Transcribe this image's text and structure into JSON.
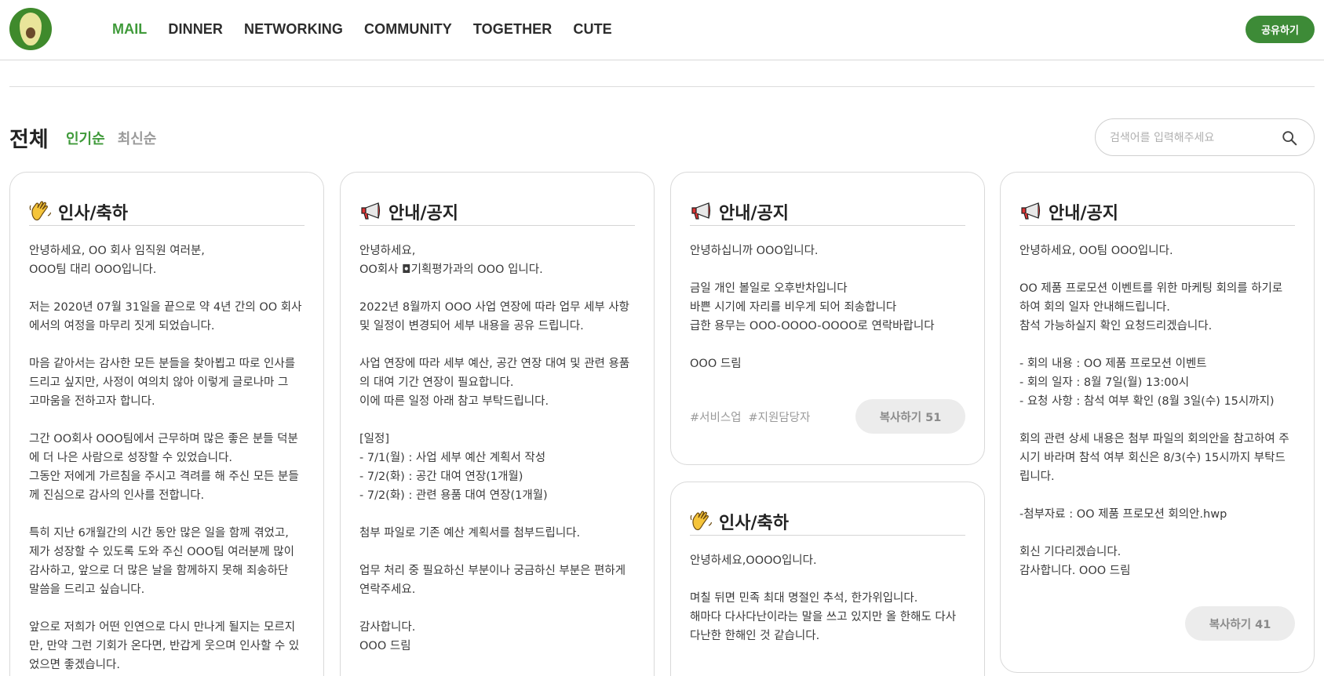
{
  "nav": {
    "items": [
      "MAIL",
      "DINNER",
      "NETWORKING",
      "COMMUNITY",
      "TOGETHER",
      "CUTE"
    ],
    "active_index": 0,
    "share_label": "공유하기"
  },
  "filter": {
    "title": "전체",
    "sort_popular": "인기순",
    "sort_latest": "최신순",
    "search_placeholder": "검색어를 입력해주세요"
  },
  "colors": {
    "brand": "#3d8b37",
    "active_nav": "#3f9a3a",
    "sort_inactive": "#9a9a9a",
    "button_gray": "#ececec"
  },
  "icons": {
    "greeting": "waving-hand-icon",
    "notice": "megaphone-icon",
    "search": "search-icon",
    "logo": "avocado-logo"
  },
  "cards": [
    {
      "category": "인사/축하",
      "icon": "waving-hand-icon",
      "body": "안녕하세요, OO 회사 임직원 여러분,\nOOO팀 대리 OOO입니다.\n\n저는 2020년 07월 31일을 끝으로 약 4년 간의 OO 회사\n에서의 여정을 마무리 짓게 되었습니다.\n\n마음 같아서는 감사한 모든 분들을 찾아뵙고 따로 인사를\n드리고 싶지만, 사정이 여의치 않아 이렇게 글로나마 그\n고마움을 전하고자 합니다.\n\n그간 OO회사 OOO팀에서 근무하며 많은 좋은 분들 덕분\n에 더 나은 사람으로 성장할 수 있었습니다.\n그동안 저에게 가르침을 주시고 격려를 해 주신 모든 분들\n께 진심으로 감사의 인사를 전합니다.\n\n특히 지난 6개월간의 시간 동안 많은 일을 함께 겪었고,\n제가 성장할 수 있도록 도와 주신 OOO팀 여러분께 많이\n감사하고, 앞으로 더 많은 날을 함께하지 못해 죄송하단\n말씀을 드리고 싶습니다.\n\n앞으로 저희가 어떤 인연으로 다시 만나게 될지는 모르지\n만, 만약 그런 기회가 온다면, 반갑게 웃으며 인사할 수 있\n었으면 좋겠습니다."
    },
    {
      "category": "안내/공지",
      "icon": "megaphone-icon",
      "body": "안녕하세요,\nOO회사 ◘기획평가과의 OOO 입니다.\n\n2022년 8월까지 OOO 사업 연장에 따라 업무 세부 사항\n및 일정이 변경되어 세부 내용을 공유 드립니다.\n\n사업 연장에 따라 세부 예산, 공간 연장 대여 및 관련 용품\n의 대여 기간 연장이 필요합니다.\n이에 따른 일정 아래 참고 부탁드립니다.\n\n[일정]\n- 7/1(월) : 사업 세부 예산 계획서 작성\n- 7/2(화) : 공간 대여 연장(1개월)\n- 7/2(화) : 관련 용품 대여 연장(1개월)\n\n첨부 파일로 기존 예산 계획서를 첨부드립니다.\n\n업무 처리 중 필요하신 부분이나 궁금하신 부분은 편하게\n연락주세요.\n\n감사합니다.\nOOO 드림"
    },
    {
      "category": "안내/공지",
      "icon": "megaphone-icon",
      "body": "안녕하십니까 OOO입니다.\n\n금일 개인 볼일로 오후반차입니다\n바쁜 시기에 자리를 비우게 되어 죄송합니다\n급한 용무는 OOO-OOOO-OOOO로 연락바랍니다\n\nOOO 드림",
      "tags": [
        "#서비스업",
        "#지원담당자"
      ],
      "copy_label": "복사하기 51"
    },
    {
      "category": "인사/축하",
      "icon": "waving-hand-icon",
      "body": "안녕하세요,OOOO입니다.\n\n며칠 뒤면 민족 최대 명절인 추석, 한가위입니다.\n해마다 다사다난이라는 말을 쓰고 있지만 올 한해도 다사\n다난한 한해인 것 같습니다."
    },
    {
      "category": "안내/공지",
      "icon": "megaphone-icon",
      "body": "안녕하세요, OO팀 OOO입니다.\n\nOO 제품 프로모션 이벤트를 위한 마케팅 회의를 하기로\n하여 회의 일자 안내해드립니다.\n참석 가능하실지 확인 요청드리겠습니다.\n\n- 회의 내용 : OO 제품 프로모션 이벤트\n- 회의 일자 : 8월 7일(월) 13:00시\n- 요청 사항 : 참석 여부 확인 (8월 3일(수) 15시까지)\n\n회의 관련 상세 내용은 첨부 파일의 회의안을 참고하여 주\n시기 바라며 참석 여부 회신은 8/3(수) 15시까지 부탁드\n립니다.\n\n-첨부자료 : OO 제품 프로모션 회의안.hwp\n\n회신 기다리겠습니다.\n감사합니다. OOO 드림",
      "copy_label": "복사하기 41"
    }
  ]
}
